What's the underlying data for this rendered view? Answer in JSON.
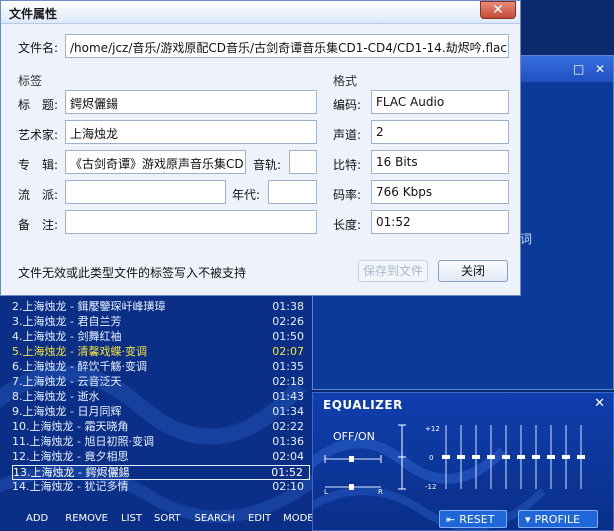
{
  "dialog": {
    "title": "文件属性",
    "close_label": "✕",
    "filename_label": "文件名:",
    "filename_value": "/home/jcz/音乐/游戏原配CD音乐/古剑奇谭音乐集CD1-CD4/CD1-14.劫烬吟.flac",
    "tags_header": "标签",
    "format_header": "格式",
    "title_label": "标　题:",
    "title_value": "鍔烬儷鍚",
    "artist_label": "艺术家:",
    "artist_value": "上海烛龙",
    "album_label": "专　辑:",
    "album_value": "《古剑奇谭》游戏原声音乐集CD1",
    "track_label": "音轨:",
    "track_value": "",
    "genre_label": "流　派:",
    "genre_value": "",
    "year_label": "年代:",
    "year_value": "",
    "comment_label": "备　注:",
    "comment_value": "",
    "codec_label": "编码:",
    "codec_value": "FLAC Audio",
    "channels_label": "声道:",
    "channels_value": "2",
    "bits_label": "比特:",
    "bits_value": "16 Bits",
    "bitrate_label": "码率:",
    "bitrate_value": "766 Kbps",
    "length_label": "长度:",
    "length_value": "01:52",
    "status_text": "文件无效或此类型文件的标签写入不被支持",
    "save_button": "保存到文件",
    "close_button": "关闭"
  },
  "playlist": {
    "rows": [
      {
        "title": "2.上海烛龙 - 鍓嬮鑒琛屽峰璜璋",
        "duration": "01:38",
        "state": "normal"
      },
      {
        "title": "3.上海烛龙 - 君自兰芳",
        "duration": "02:26",
        "state": "normal"
      },
      {
        "title": "4.上海烛龙 - 剑舞红袖",
        "duration": "01:50",
        "state": "normal"
      },
      {
        "title": "5.上海烛龙 - 清馨戏蝶·变调",
        "duration": "02:07",
        "state": "active"
      },
      {
        "title": "6.上海烛龙 - 醉饮千觞·变调",
        "duration": "01:35",
        "state": "normal"
      },
      {
        "title": "7.上海烛龙 - 云音泛天",
        "duration": "02:18",
        "state": "normal"
      },
      {
        "title": "8.上海烛龙 - 逝水",
        "duration": "01:43",
        "state": "normal"
      },
      {
        "title": "9.上海烛龙 - 日月同辉",
        "duration": "01:34",
        "state": "normal"
      },
      {
        "title": "10.上海烛龙 - 霜天晓角",
        "duration": "02:22",
        "state": "normal"
      },
      {
        "title": "11.上海烛龙 - 旭日初照·变调",
        "duration": "01:36",
        "state": "normal"
      },
      {
        "title": "12.上海烛龙 - 竟夕相思",
        "duration": "02:04",
        "state": "normal"
      },
      {
        "title": "13.上海烛龙 - 鍔烬儷鍚",
        "duration": "01:52",
        "state": "current"
      },
      {
        "title": "14.上海烛龙 - 犹记多情",
        "duration": "02:10",
        "state": "normal"
      }
    ],
    "actions": [
      "ADD",
      "REMOVE",
      "LIST",
      "SORT",
      "SEARCH",
      "EDIT",
      "MODE"
    ]
  },
  "equalizer": {
    "title": "EQUALIZER",
    "onoff": "OFF/ON",
    "scale_top": "+12",
    "scale_mid": "0",
    "scale_bottom": "-12",
    "reset": "RESET",
    "profile": "PROFILE",
    "left_marker": "L",
    "right_marker": "R"
  },
  "background_window": {
    "partial_text": "词"
  }
}
